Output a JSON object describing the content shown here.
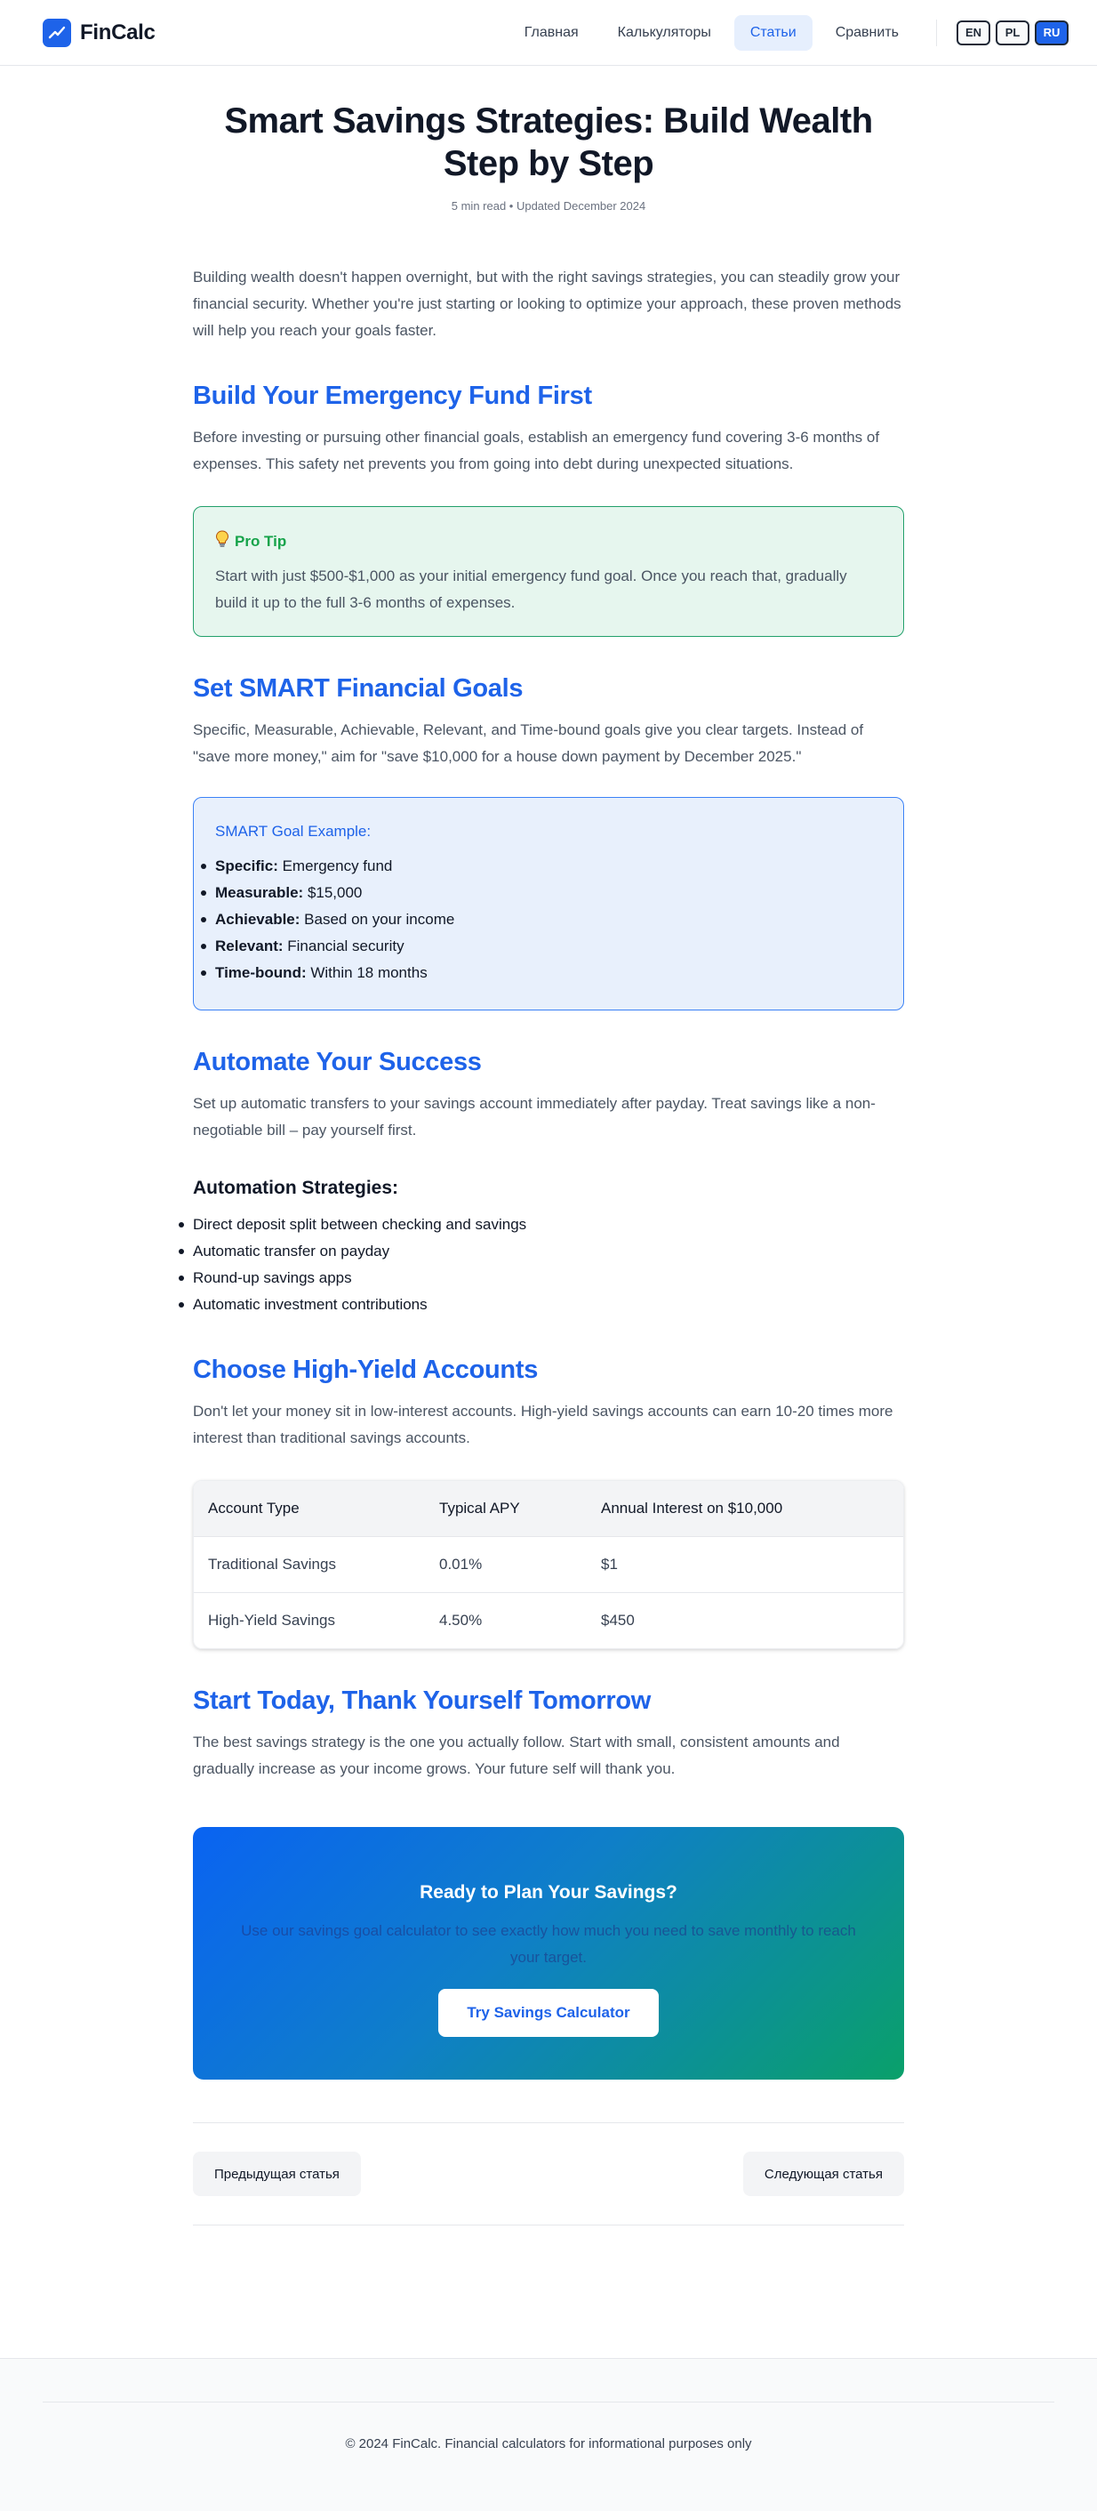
{
  "header": {
    "brand": "FinCalc",
    "nav": [
      {
        "label": "Главная",
        "active": false
      },
      {
        "label": "Калькуляторы",
        "active": false
      },
      {
        "label": "Статьи",
        "active": true
      },
      {
        "label": "Сравнить",
        "active": false
      }
    ],
    "languages": [
      "EN",
      "PL",
      "RU"
    ],
    "active_language": "RU"
  },
  "article": {
    "title": "Smart Savings Strategies: Build Wealth Step by Step",
    "meta": "5 min read • Updated December 2024",
    "lead": "Building wealth doesn't happen overnight, but with the right savings strategies, you can steadily grow your financial security. Whether you're just starting or looking to optimize your approach, these proven methods will help you reach your goals faster.",
    "emergency": {
      "title": "Build Your Emergency Fund First",
      "body": "Before investing or pursuing other financial goals, establish an emergency fund covering 3-6 months of expenses. This safety net prevents you from going into debt during unexpected situations.",
      "tip_title": "Pro Tip",
      "tip_text": "Start with just $500-$1,000 as your initial emergency fund goal. Once you reach that, gradually build it up to the full 3-6 months of expenses."
    },
    "smart": {
      "title": "Set SMART Financial Goals",
      "body": "Specific, Measurable, Achievable, Relevant, and Time-bound goals give you clear targets. Instead of \"save more money,\" aim for \"save $10,000 for a house down payment by December 2025.\"",
      "example_title": "SMART Goal Example:",
      "items": [
        {
          "term": "Specific:",
          "value": "Emergency fund"
        },
        {
          "term": "Measurable:",
          "value": "$15,000"
        },
        {
          "term": "Achievable:",
          "value": "Based on your income"
        },
        {
          "term": "Relevant:",
          "value": "Financial security"
        },
        {
          "term": "Time-bound:",
          "value": "Within 18 months"
        }
      ]
    },
    "automate": {
      "title": "Automate Your Success",
      "body": "Set up automatic transfers to your savings account immediately after payday. Treat savings like a non-negotiable bill – pay yourself first.",
      "sub_title": "Automation Strategies:",
      "items": [
        "Direct deposit split between checking and savings",
        "Automatic transfer on payday",
        "Round-up savings apps",
        "Automatic investment contributions"
      ]
    },
    "accounts": {
      "title": "Choose High-Yield Accounts",
      "body": "Don't let your money sit in low-interest accounts. High-yield savings accounts can earn 10-20 times more interest than traditional savings accounts.",
      "columns": [
        "Account Type",
        "Typical APY",
        "Annual Interest on $10,000"
      ],
      "rows": [
        [
          "Traditional Savings",
          "0.01%",
          "$1"
        ],
        [
          "High-Yield Savings",
          "4.50%",
          "$450"
        ]
      ]
    },
    "start": {
      "title": "Start Today, Thank Yourself Tomorrow",
      "body": "The best savings strategy is the one you actually follow. Start with small, consistent amounts and gradually increase as your income grows. Your future self will thank you."
    },
    "cta": {
      "title": "Ready to Plan Your Savings?",
      "text": "Use our savings goal calculator to see exactly how much you need to save monthly to reach your target.",
      "button": "Try Savings Calculator"
    },
    "pager": {
      "prev": "Предыдущая статья",
      "next": "Следующая статья"
    }
  },
  "footer": {
    "text": "© 2024 FinCalc. Financial calculators for informational purposes only"
  },
  "colors": {
    "accent": "#1e63e9",
    "tip_green": "#16a34a",
    "cta_gradient_start": "#0a63f2",
    "cta_gradient_end": "#0aa06a"
  },
  "icons": {
    "logo": "trend-up-icon",
    "tip": "lightbulb-icon"
  }
}
